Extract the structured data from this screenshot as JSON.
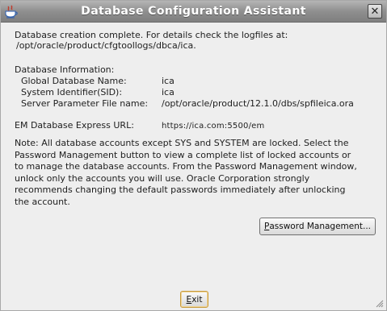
{
  "window": {
    "title": "Database Configuration Assistant",
    "close_glyph": "✕"
  },
  "completion": {
    "line1": "Database creation complete. For details check the logfiles at:",
    "line2": "/opt/oracle/product/cfgtoollogs/dbca/ica."
  },
  "db_info": {
    "heading": "Database Information:",
    "rows": [
      {
        "label": "Global Database Name:",
        "value": "ica"
      },
      {
        "label": "System Identifier(SID):",
        "value": "ica"
      },
      {
        "label": "Server Parameter File name:",
        "value": "/opt/oracle/product/12.1.0/dbs/spfileica.ora"
      }
    ]
  },
  "em": {
    "label": "EM Database Express URL:",
    "url": "https://ica.com:5500/em"
  },
  "note": {
    "lines": [
      "Note: All database accounts except SYS and SYSTEM are locked. Select the",
      "Password Management button to view a complete list of locked accounts or",
      "to manage the database accounts. From the Password Management window,",
      "unlock only the accounts you will use. Oracle Corporation strongly",
      "recommends changing the default passwords immediately after unlocking",
      "the account."
    ]
  },
  "buttons": {
    "password_management_first": "P",
    "password_management_rest": "assword Management...",
    "exit_first": "E",
    "exit_rest": "xit"
  },
  "icons": {
    "app": "java-coffee-cup-icon",
    "close": "close-icon",
    "resize": "resize-grip-icon"
  }
}
